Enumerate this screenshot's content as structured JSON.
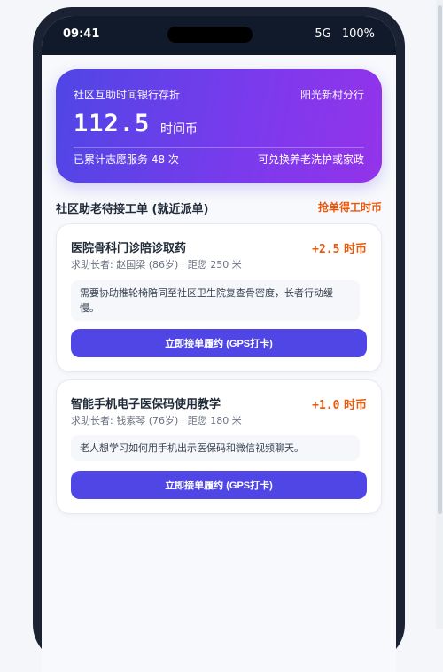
{
  "status_bar": {
    "time": "09:41",
    "network": "5G",
    "battery": "100%"
  },
  "bank_card": {
    "title": "社区互助时间银行存折",
    "branch": "阳光新村分行",
    "balance": "112.5",
    "unit": "时间币",
    "service_count": "已累计志愿服务 48 次",
    "redeem_text": "可兑换养老洗护或家政"
  },
  "section": {
    "title": "社区助老待接工单 (就近派单)",
    "hint": "抢单得工时币"
  },
  "orders": [
    {
      "title": "医院骨科门诊陪诊取药",
      "reward": "+2.5",
      "reward_unit": "时币",
      "meta": "求助长者: 赵国梁 (86岁) · 距您 250 米",
      "desc": "需要协助推轮椅陪同至社区卫生院复查骨密度，长者行动缓慢。",
      "button": "立即接单履约 (GPS打卡)"
    },
    {
      "title": "智能手机电子医保码使用教学",
      "reward": "+1.0",
      "reward_unit": "时币",
      "meta": "求助长者: 钱素琴 (76岁) · 距您 180 米",
      "desc": "老人想学习如何用手机出示医保码和微信视频聊天。",
      "button": "立即接单履约 (GPS打卡)"
    }
  ]
}
